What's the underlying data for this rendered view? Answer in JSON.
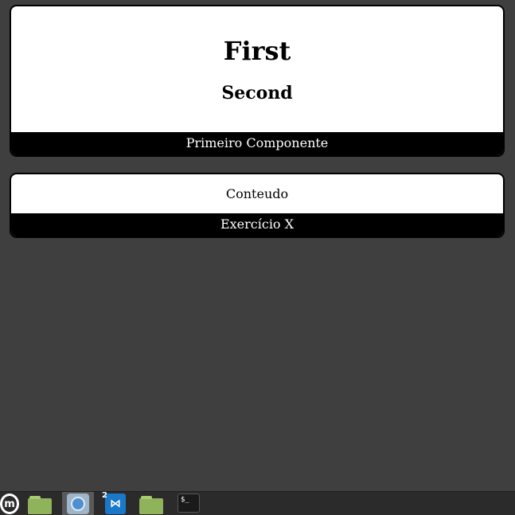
{
  "cards": [
    {
      "title": "First",
      "subtitle": "Second",
      "footer": "Primeiro Componente"
    },
    {
      "content": "Conteudo",
      "footer": "Exercício X"
    }
  ],
  "taskbar": {
    "menu_logo_letter": "m",
    "items": [
      {
        "icon": "menu-icon"
      },
      {
        "icon": "folder-icon"
      },
      {
        "icon": "browser-icon"
      },
      {
        "icon": "vscode-icon",
        "badge": "2"
      },
      {
        "icon": "folder-icon"
      },
      {
        "icon": "terminal-icon",
        "glyph": "$_"
      }
    ]
  },
  "colors": {
    "background": "#3f3f3f",
    "card": "#ffffff",
    "footer": "#000000",
    "taskbar": "#2b2b2b"
  }
}
